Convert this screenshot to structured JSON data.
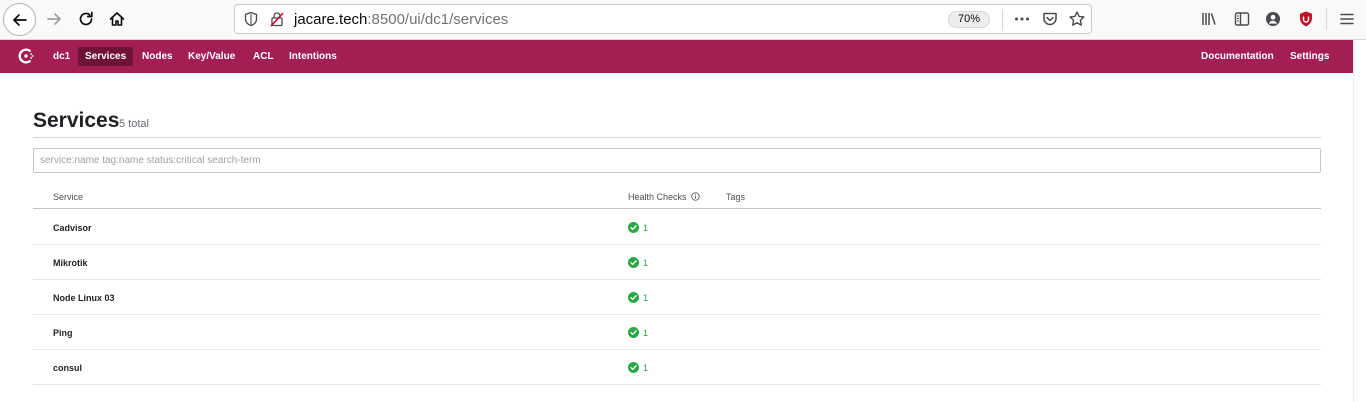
{
  "browser": {
    "url_host": "jacare.tech",
    "url_rest": ":8500/ui/dc1/services",
    "zoom": "70%"
  },
  "nav": {
    "datacenter": "dc1",
    "items": [
      "Services",
      "Nodes",
      "Key/Value",
      "ACL",
      "Intentions"
    ],
    "active": "Services",
    "right_items": [
      "Documentation",
      "Settings"
    ]
  },
  "page": {
    "title": "Services",
    "count": "5 total"
  },
  "search": {
    "placeholder": "service:name tag:name status:critical search-term",
    "value": ""
  },
  "table": {
    "columns": [
      "Service",
      "Health Checks",
      "Tags"
    ],
    "rows": [
      {
        "name": "Cadvisor",
        "checks": "1",
        "tags": ""
      },
      {
        "name": "Mikrotik",
        "checks": "1",
        "tags": ""
      },
      {
        "name": "Node Linux 03",
        "checks": "1",
        "tags": ""
      },
      {
        "name": "Ping",
        "checks": "1",
        "tags": ""
      },
      {
        "name": "consul",
        "checks": "1",
        "tags": ""
      }
    ]
  },
  "icons": {
    "back": "arrow-left-icon",
    "forward": "arrow-right-icon",
    "reload": "reload-icon",
    "home": "home-icon",
    "passing": "check-circle-icon",
    "info": "info-icon"
  },
  "colors": {
    "brand": "#a21e55",
    "brand_active": "#6f1238",
    "passing": "#28a745"
  }
}
